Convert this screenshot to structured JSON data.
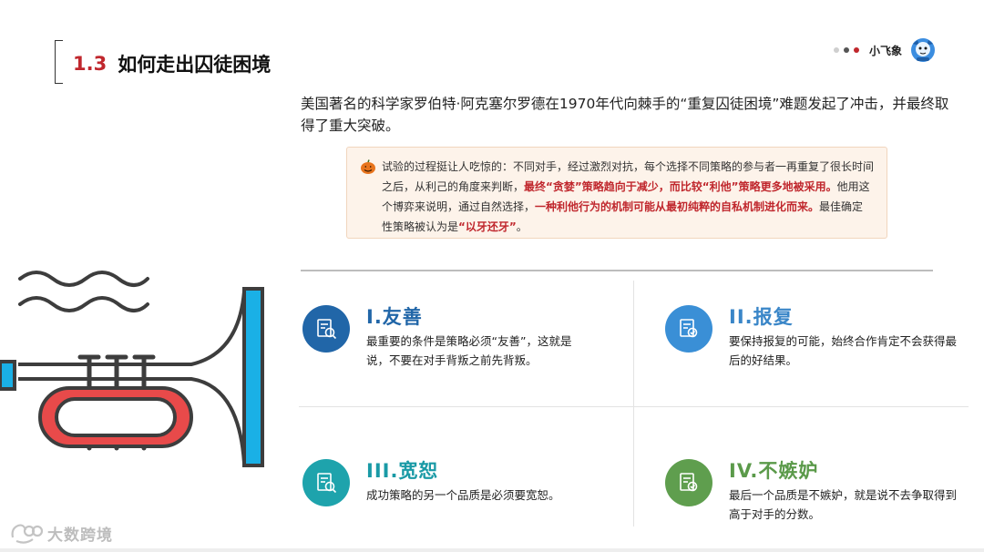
{
  "header": {
    "section_number": "1.3",
    "title": "如何走出囚徒困境"
  },
  "brand": {
    "name": "小飞象",
    "dot_colors": [
      "#cfcfcf",
      "#555555",
      "#c0272d"
    ]
  },
  "intro_text": "美国著名的科学家罗伯特·阿克塞尔罗德在1970年代向棘手的“重复囚徒困境”难题发起了冲击，并最终取得了重大突破。",
  "note": {
    "part1": "试验的过程挺让人吃惊的：不同对手，经过激烈对抗，每个选择不同策略的参与者一再重复了很长时间之后，从利己的角度来判断，",
    "highlight1": "最终“贪婪”策略趋向于减少，而比较“利他”策略更多地被采用。",
    "part2": "他用这个博弈来说明，通过自然选择，",
    "highlight2": "一种利他行为的机制可能从最初纯粹的自私机制进化而来。",
    "part3": "最佳确定性策略被认为是",
    "highlight3": "“以牙还牙”",
    "part4": "。"
  },
  "cards": [
    {
      "title": "I.友善",
      "desc": "最重要的条件是策略必须“友善”，这就是说，不要在对手背叛之前先背叛。",
      "color": "#2166a8",
      "circle_color": "#2166a8"
    },
    {
      "title": "II.报复",
      "desc": "要保持报复的可能，始终合作肯定不会获得最后的好结果。",
      "color": "#3a86c8",
      "circle_color": "#3a8fd6"
    },
    {
      "title": "III.宽恕",
      "desc": "成功策略的另一个品质是必须要宽恕。",
      "color": "#1a9aa6",
      "circle_color": "#1ea3ac"
    },
    {
      "title": "IV.不嫉妒",
      "desc": "最后一个品质是不嫉妒，就是说不去争取得到高于对手的分数。",
      "color": "#5b9a4a",
      "circle_color": "#5f9e4e"
    }
  ],
  "watermark": {
    "text": "大数跨境"
  },
  "colors": {
    "accent_red": "#c0272d",
    "trumpet_blue": "#1ab0e6",
    "trumpet_dark": "#3d3d3d",
    "trumpet_red": "#e84a4a"
  }
}
